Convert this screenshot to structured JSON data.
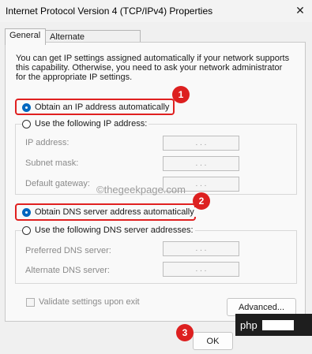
{
  "window": {
    "title": "Internet Protocol Version 4 (TCP/IPv4) Properties",
    "close_glyph": "✕"
  },
  "tabs": [
    {
      "label": "General",
      "active": true
    },
    {
      "label": "Alternate Configuration",
      "active": false
    }
  ],
  "info_text": "You can get IP settings assigned automatically if your network supports this capability. Otherwise, you need to ask your network administrator for the appropriate IP settings.",
  "ip_section": {
    "auto_label": "Obtain an IP address automatically",
    "manual_label": "Use the following IP address:",
    "fields": [
      {
        "label": "IP address:",
        "value": ". . ."
      },
      {
        "label": "Subnet mask:",
        "value": ". . ."
      },
      {
        "label": "Default gateway:",
        "value": ". . ."
      }
    ]
  },
  "dns_section": {
    "auto_label": "Obtain DNS server address automatically",
    "manual_label": "Use the following DNS server addresses:",
    "fields": [
      {
        "label": "Preferred DNS server:",
        "value": ". . ."
      },
      {
        "label": "Alternate DNS server:",
        "value": ". . ."
      }
    ]
  },
  "validate_label": "Validate settings upon exit",
  "advanced_label": "Advanced...",
  "ok_label": "OK",
  "watermark": "©thegeekpage.com",
  "badges": [
    "1",
    "2",
    "3"
  ],
  "php_label": "php",
  "colors": {
    "highlight": "#e02020",
    "badge": "#dd2020",
    "radio_checked": "#0067c0"
  }
}
